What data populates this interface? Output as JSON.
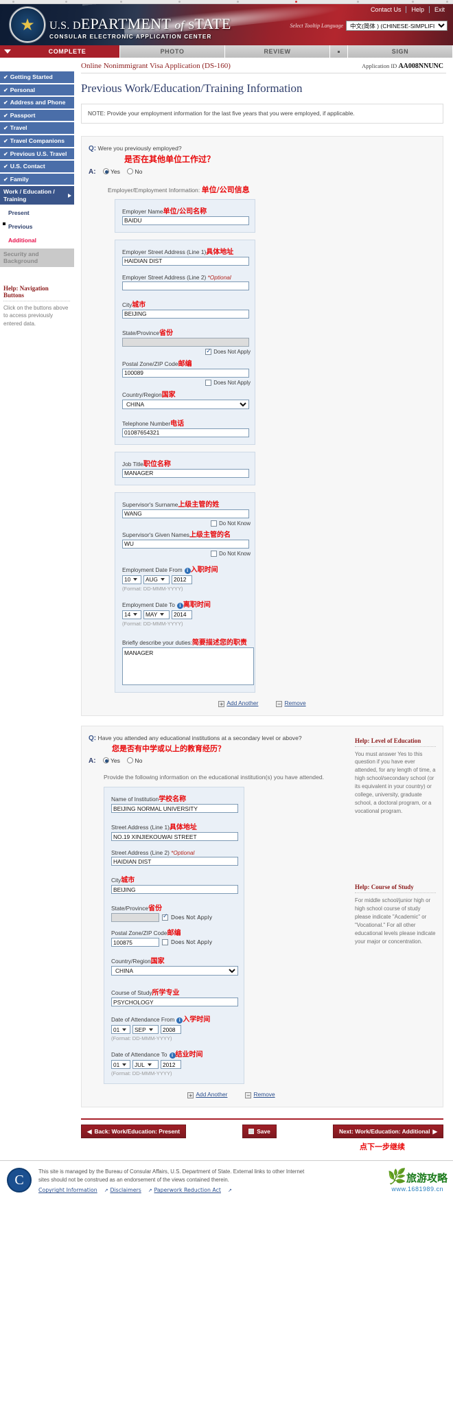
{
  "header": {
    "top_links": [
      "Contact Us",
      "Help",
      "Exit"
    ],
    "dept_line1_prefix": "U.S. D",
    "dept_line1": "U.S. DEPARTMENT of STATE",
    "dept_line2": "CONSULAR ELECTRONIC APPLICATION CENTER",
    "tooltip_language_label": "Select Tooltip Language",
    "tooltip_language_value": "中文(简体 ) (CHINESE-SIMPLIFIED)"
  },
  "navtabs": [
    {
      "label": "COMPLETE",
      "state": "active"
    },
    {
      "label": "PHOTO",
      "state": "inactive"
    },
    {
      "label": "REVIEW",
      "state": "inactive"
    },
    {
      "label": "",
      "state": "inactive-narrow"
    },
    {
      "label": "SIGN",
      "state": "inactive"
    }
  ],
  "sidebar": {
    "items": [
      {
        "label": "Getting Started",
        "check": "✔",
        "state": "done"
      },
      {
        "label": "Personal",
        "check": "✔",
        "state": "done"
      },
      {
        "label": "Address and Phone",
        "check": "✔",
        "state": "done"
      },
      {
        "label": "Passport",
        "check": "✔",
        "state": "done"
      },
      {
        "label": "Travel",
        "check": "✔",
        "state": "done"
      },
      {
        "label": "Travel Companions",
        "check": "✔",
        "state": "done"
      },
      {
        "label": "Previous U.S. Travel",
        "check": "✔",
        "state": "done"
      },
      {
        "label": "U.S. Contact",
        "check": "✔",
        "state": "done"
      },
      {
        "label": "Family",
        "check": "✔",
        "state": "done"
      },
      {
        "label": "Work / Education / Training",
        "check": "",
        "state": "current"
      }
    ],
    "subitems": [
      {
        "label": "Present",
        "style": "normal"
      },
      {
        "label": "Previous",
        "style": "selected"
      },
      {
        "label": "Additional",
        "style": "alt"
      }
    ],
    "disabled_item": {
      "label": "Security and Background"
    },
    "help": {
      "title_bold": "Help:",
      "title_rest": " Navigation Buttons",
      "body": "Click on the buttons above to access previously entered data."
    }
  },
  "app": {
    "form_title": "Online Nonimmigrant Visa Application (DS-160)",
    "application_id_label": "Application ID ",
    "application_id": "AA008NNUNC",
    "page_title": "Previous Work/Education/Training Information",
    "note": "NOTE: Provide your employment information for the last five years that you were employed, if applicable."
  },
  "employment": {
    "question": "Were you previously employed?",
    "question_cn": "是否在其他单位工作过？",
    "q_marker": "Q:",
    "a_marker": "A:",
    "yes_label": "Yes",
    "no_label": "No",
    "answer": "Yes",
    "section_label": "Employer/Employment Information:",
    "section_label_cn": "单位/公司信息",
    "fields": {
      "employer_name_label": "Employer Name",
      "employer_name_cn": "单位/公司名称",
      "employer_name_value": "BAIDU",
      "street1_label": "Employer Street Address (Line 1)",
      "street1_cn": "具体地址",
      "street1_value": "HAIDIAN DIST",
      "street2_label": "Employer Street Address (Line 2)",
      "street2_optional": "*Optional",
      "street2_value": "",
      "city_label": "City",
      "city_cn": "城市",
      "city_value": "BEIJING",
      "state_label": "State/Province",
      "state_cn": "省份",
      "state_value": "",
      "state_dna_label": "Does Not Apply",
      "state_dna_checked": true,
      "postal_label": "Postal Zone/ZIP Code",
      "postal_cn": "邮编",
      "postal_value": "100089",
      "postal_dna_label": "Does Not Apply",
      "postal_dna_checked": false,
      "country_label": "Country/Region",
      "country_cn": "国家",
      "country_value": "CHINA",
      "phone_label": "Telephone Number",
      "phone_cn": "电话",
      "phone_value": "01087654321",
      "jobtitle_label": "Job Title",
      "jobtitle_cn": "职位名称",
      "jobtitle_value": "MANAGER",
      "sup_surname_label": "Supervisor's Surname",
      "sup_surname_cn": "上级主管的姓",
      "sup_surname_value": "WANG",
      "sup_surname_dk_label": "Do Not Know",
      "sup_given_label": "Supervisor's Given Names",
      "sup_given_cn": "上级主管的名",
      "sup_given_value": "WU",
      "sup_given_dk_label": "Do Not Know",
      "from_label": "Employment Date From",
      "from_cn": "入职时间",
      "from_day": "10",
      "from_month": "AUG",
      "from_year": "2012",
      "to_label": "Employment Date To",
      "to_cn": "离职时间",
      "to_day": "14",
      "to_month": "MAY",
      "to_year": "2014",
      "date_format": "(Format: DD-MMM-YYYY)",
      "duties_label": "Briefly describe your duties:",
      "duties_cn": "简要描述您的职责",
      "duties_value": "MANAGER"
    },
    "add_another": "Add Another",
    "remove": "Remove"
  },
  "education": {
    "question": "Have you attended any educational institutions at a secondary level or above?",
    "question_cn": "您是否有中学或以上的教育经历？",
    "q_marker": "Q:",
    "a_marker": "A:",
    "yes_label": "Yes",
    "no_label": "No",
    "answer": "Yes",
    "instruction": "Provide the following information on the educational institution(s) you have attended.",
    "fields": {
      "institution_label": "Name of Institution",
      "institution_cn": "学校名称",
      "institution_value": "BEIJING NORMAL UNIVERSITY",
      "street1_label": "Street Address (Line 1)",
      "street1_cn": "具体地址",
      "street1_value": "NO.19 XINJIEKOUWAI STREET",
      "street2_label": "Street Address (Line 2)",
      "street2_optional": "*Optional",
      "street2_value": "HAIDIAN DIST",
      "city_label": "City",
      "city_cn": "城市",
      "city_value": "BEIJING",
      "state_label": "State/Province",
      "state_cn": "省份",
      "state_value": "",
      "state_dna_label": "Does Not Apply",
      "state_dna_checked": true,
      "postal_label": "Postal Zone/ZIP Code",
      "postal_cn": "邮编",
      "postal_value": "100875",
      "postal_dna_label": "Does Not Apply",
      "postal_dna_checked": false,
      "country_label": "Country/Region",
      "country_cn": "国家",
      "country_value": "CHINA",
      "course_label": "Course of Study",
      "course_cn": "所学专业",
      "course_value": "PSYCHOLOGY",
      "from_label": "Date of Attendance From",
      "from_cn": "入学时间",
      "from_day": "01",
      "from_month": "SEP",
      "from_year": "2008",
      "to_label": "Date of Attendance To",
      "to_cn": "结业时间",
      "to_day": "01",
      "to_month": "JUL",
      "to_year": "2012",
      "date_format": "(Format: DD-MMM-YYYY)"
    },
    "add_another": "Add Another",
    "remove": "Remove",
    "help_level": {
      "title_bold": "Help:",
      "title_rest": " Level of Education",
      "body": "You must answer Yes to this question if you have ever attended, for any length of time, a high school/secondary school (or its equivalent in your country) or college, university, graduate school, a doctoral program, or a vocational program."
    },
    "help_course": {
      "title_bold": "Help:",
      "title_rest": " Course of Study",
      "body": "For middle school/junior high or high school course of study please indicate \"Academic\" or \"Vocational.\" For all other educational levels please indicate your major or concentration."
    }
  },
  "buttons": {
    "back": "Back: Work/Education: Present",
    "save": "Save",
    "next": "Next: Work/Education: Additional",
    "next_hint_cn": "点下一步继续"
  },
  "footer": {
    "text": "This site is managed by the Bureau of Consular Affairs, U.S. Department of State. External links to other Internet sites should not be construed as an endorsement of the views contained therein.",
    "links": [
      "Copyright Information",
      "Disclaimers",
      "Paperwork Reduction Act"
    ]
  },
  "watermark": {
    "title": "旅游攻略",
    "url": "www.1681989.cn"
  }
}
